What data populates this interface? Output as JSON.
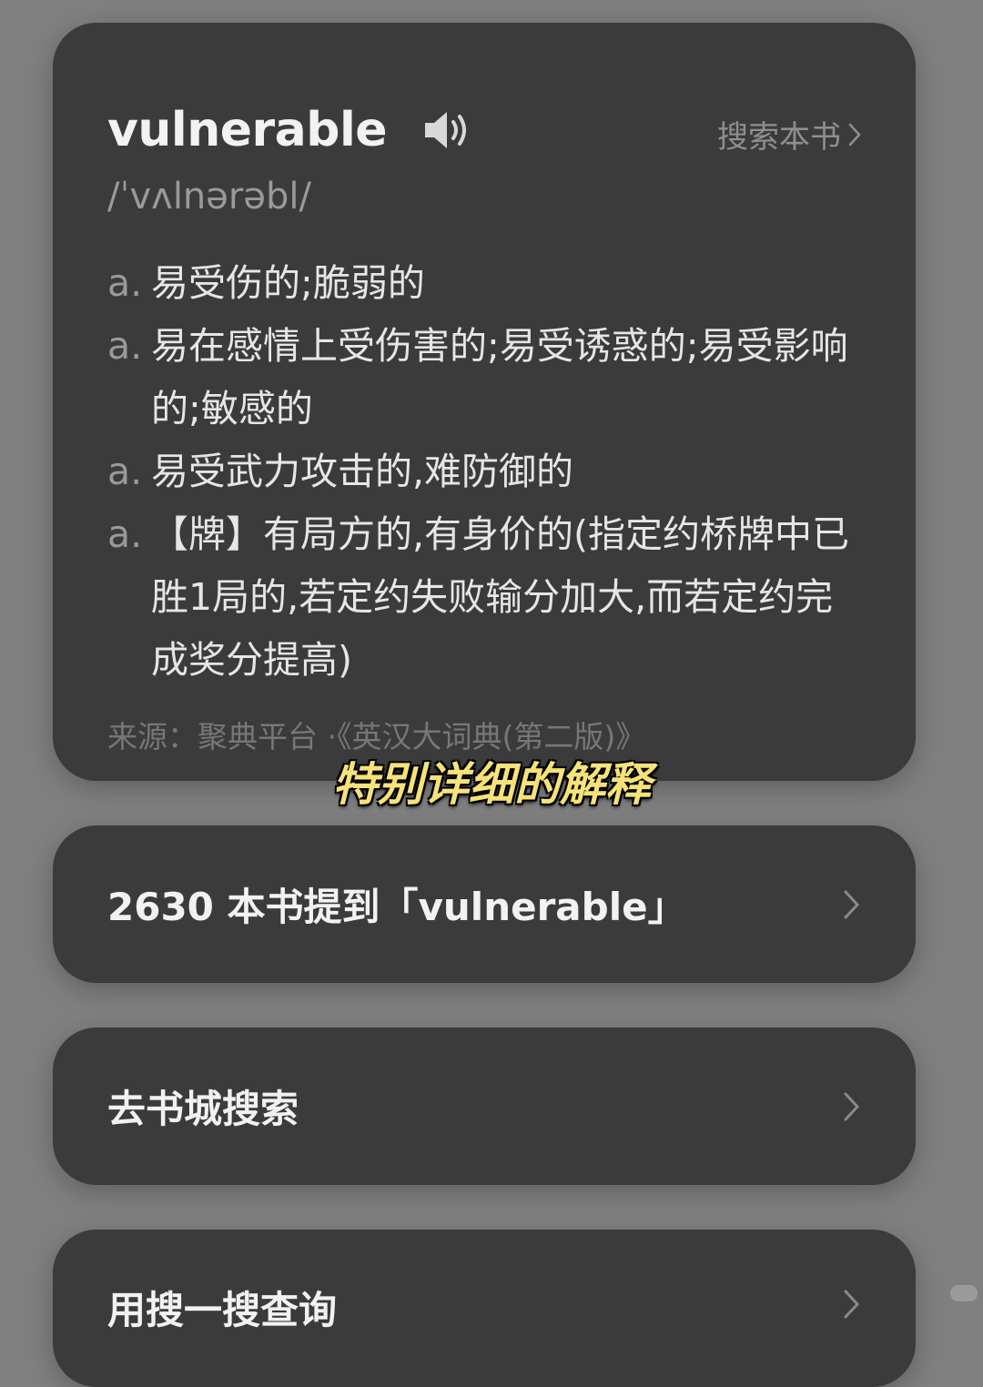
{
  "dictionary": {
    "word": "vulnerable",
    "phonetic": "/ˈvʌlnərəbl/",
    "search_book_label": "搜索本书",
    "definitions": [
      {
        "pos": "a.",
        "text": "易受伤的;脆弱的"
      },
      {
        "pos": "a.",
        "text": "易在感情上受伤害的;易受诱惑的;易受影响的;敏感的"
      },
      {
        "pos": "a.",
        "text": "易受武力攻击的,难防御的"
      },
      {
        "pos": "a.",
        "text": "【牌】有局方的,有身价的(指定约桥牌中已胜1局的,若定约失败输分加大,而若定约完成奖分提高)"
      }
    ],
    "source": "来源：聚典平台 ·《英汉大词典(第二版)》"
  },
  "subtitle": "特别详细的解释",
  "mentions": {
    "label": "2630 本书提到「vulnerable」"
  },
  "bookstore": {
    "label": "去书城搜索"
  },
  "sousou": {
    "label": "用搜一搜查询"
  }
}
